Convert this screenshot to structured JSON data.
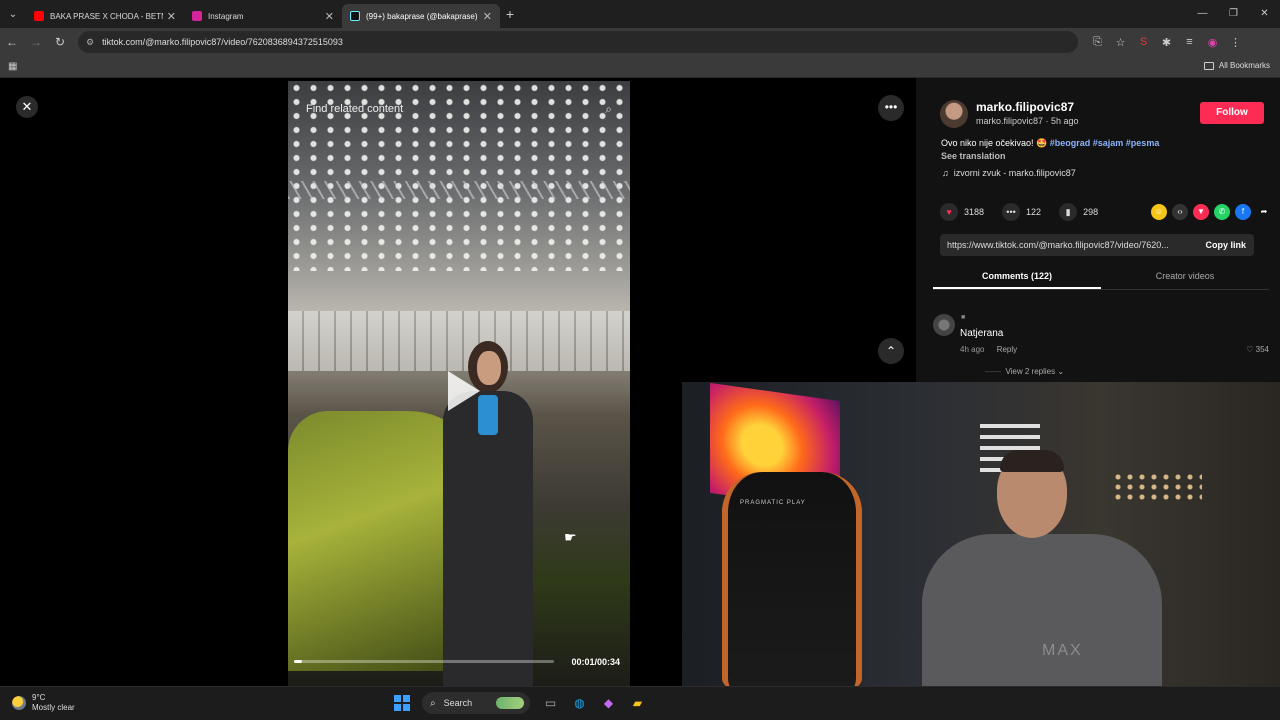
{
  "browser": {
    "tabs": [
      {
        "title": "BAKA PRASE X CHODA - BETMI...",
        "icon_color": "#ff0000",
        "active": false
      },
      {
        "title": "Instagram",
        "icon_color": "#d6249f",
        "active": false
      },
      {
        "title": "(99+) bakaprase (@bakaprase) |...",
        "icon_color": "#111111",
        "active": true
      }
    ],
    "url": "tiktok.com/@marko.filipovic87/video/7620836894372515093",
    "bookmarks_label": "All Bookmarks"
  },
  "video": {
    "search_placeholder": "Find related content",
    "timecode": "00:01/00:34",
    "progress": 0.03
  },
  "post": {
    "author_name": "marko.filipovic87",
    "author_sub": "marko.filipovic87 · 5h ago",
    "follow_label": "Follow",
    "caption_text": "Ovo niko nije očekivao! 🤩 ",
    "hashtags": "#beograd #sajam #pesma",
    "see_translation": "See translation",
    "music": "izvorni zvuk - marko.filipovic87",
    "likes": "3188",
    "comments": "122",
    "saves": "298",
    "share_link": "https://www.tiktok.com/@marko.filipovic87/video/7620...",
    "copy_link_label": "Copy link",
    "tab_comments": "Comments (122)",
    "tab_creator": "Creator videos"
  },
  "comment": {
    "badge": "■",
    "name": "Natjerana",
    "time": "4h ago",
    "reply_label": "Reply",
    "likes": "354",
    "view_replies": "View 2 replies"
  },
  "webcam": {
    "chair_label": "PRAGMATIC PLAY",
    "shirt_text": "MAX"
  },
  "taskbar": {
    "temperature": "9°C",
    "condition": "Mostly clear",
    "search_label": "Search"
  },
  "colors": {
    "accent": "#fe2c55",
    "hashtag": "#8ab4ff"
  }
}
